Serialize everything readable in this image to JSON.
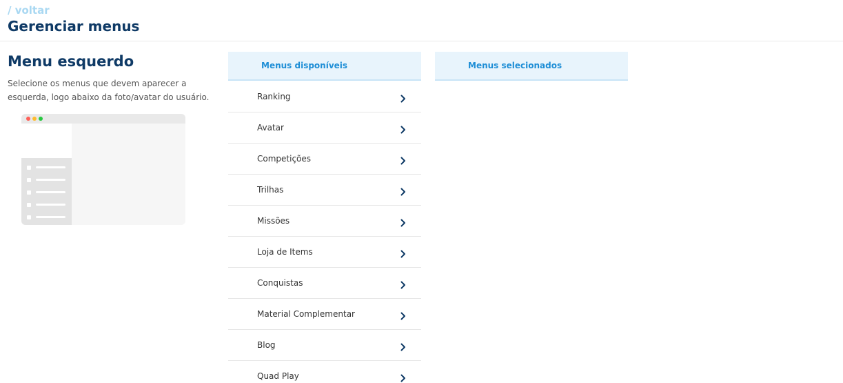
{
  "header": {
    "back_label": "/ voltar",
    "title": "Gerenciar menus"
  },
  "section": {
    "title": "Menu esquerdo",
    "description": "Selecione os menus que devem aparecer a esquerda, logo abaixo da foto/avatar do usuário."
  },
  "preview": {
    "dot_colors": [
      "#ff5f57",
      "#febc2e",
      "#28c840"
    ],
    "sidebar_color": "#e3e3e3"
  },
  "available": {
    "header": "Menus disponíveis",
    "items": [
      {
        "label": "Ranking",
        "icon": "chevron-right-icon"
      },
      {
        "label": "Avatar",
        "icon": "chevron-right-icon"
      },
      {
        "label": "Competições",
        "icon": "chevron-right-icon"
      },
      {
        "label": "Trilhas",
        "icon": "chevron-right-icon"
      },
      {
        "label": "Missões",
        "icon": "chevron-right-icon"
      },
      {
        "label": "Loja de Items",
        "icon": "chevron-right-icon"
      },
      {
        "label": "Conquistas",
        "icon": "chevron-right-icon"
      },
      {
        "label": "Material Complementar",
        "icon": "chevron-right-icon"
      },
      {
        "label": "Blog",
        "icon": "chevron-right-icon"
      },
      {
        "label": "Quad Play",
        "icon": "chevron-right-icon"
      }
    ]
  },
  "selected": {
    "header": "Menus selecionados",
    "items": []
  },
  "colors": {
    "primary_dark": "#0f3a66",
    "accent_blue": "#1e8ed6",
    "header_bg": "#e8f4fc",
    "back_link": "#a9d8f2"
  }
}
